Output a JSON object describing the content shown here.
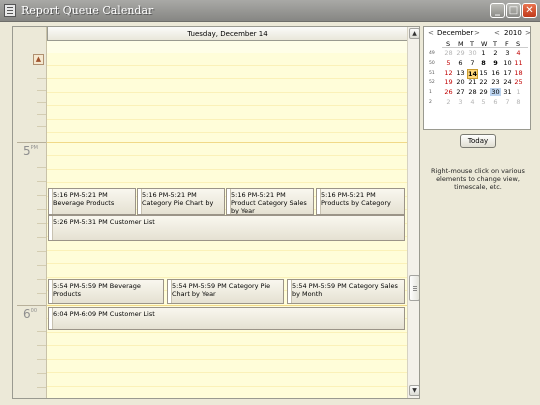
{
  "window": {
    "title": "Report Queue Calendar",
    "minimize_label": "_",
    "restore_label": "□",
    "close_label": "✕"
  },
  "day_view": {
    "header": "Tuesday, December 14",
    "hours": [
      {
        "label": "5",
        "suffix": "PM"
      },
      {
        "label": "6",
        "suffix": "00"
      }
    ],
    "appointments": [
      {
        "text": "5:16 PM-5:21 PM Beverage Products"
      },
      {
        "text": "5:16 PM-5:21 PM Category Pie Chart by"
      },
      {
        "text": "5:16 PM-5:21 PM Product Category Sales by Year"
      },
      {
        "text": "5:16 PM-5:21 PM Products by Category"
      },
      {
        "text": "5:26 PM-5:31 PM Customer List"
      },
      {
        "text": "5:54 PM-5:59 PM Beverage Products"
      },
      {
        "text": "5:54 PM-5:59 PM Category Pie Chart by Year"
      },
      {
        "text": "5:54 PM-5:59 PM Category Sales by Month"
      },
      {
        "text": "6:04 PM-6:09 PM Customer List"
      }
    ]
  },
  "calendar": {
    "month": "December",
    "year": "2010",
    "weekdays": [
      "S",
      "M",
      "T",
      "W",
      "T",
      "F",
      "S"
    ],
    "weeks": [
      {
        "wk": "49",
        "days": [
          "28",
          "29",
          "30",
          "1",
          "2",
          "3",
          "4"
        ]
      },
      {
        "wk": "50",
        "days": [
          "5",
          "6",
          "7",
          "8",
          "9",
          "10",
          "11"
        ]
      },
      {
        "wk": "51",
        "days": [
          "12",
          "13",
          "14",
          "15",
          "16",
          "17",
          "18"
        ]
      },
      {
        "wk": "52",
        "days": [
          "19",
          "20",
          "21",
          "22",
          "23",
          "24",
          "25"
        ]
      },
      {
        "wk": "1",
        "days": [
          "26",
          "27",
          "28",
          "29",
          "30",
          "31",
          "1"
        ]
      },
      {
        "wk": "2",
        "days": [
          "2",
          "3",
          "4",
          "5",
          "6",
          "7",
          "8"
        ]
      }
    ],
    "today_label": "Today"
  },
  "hint": "Right-mouse click on various elements to change view, timescale, etc."
}
